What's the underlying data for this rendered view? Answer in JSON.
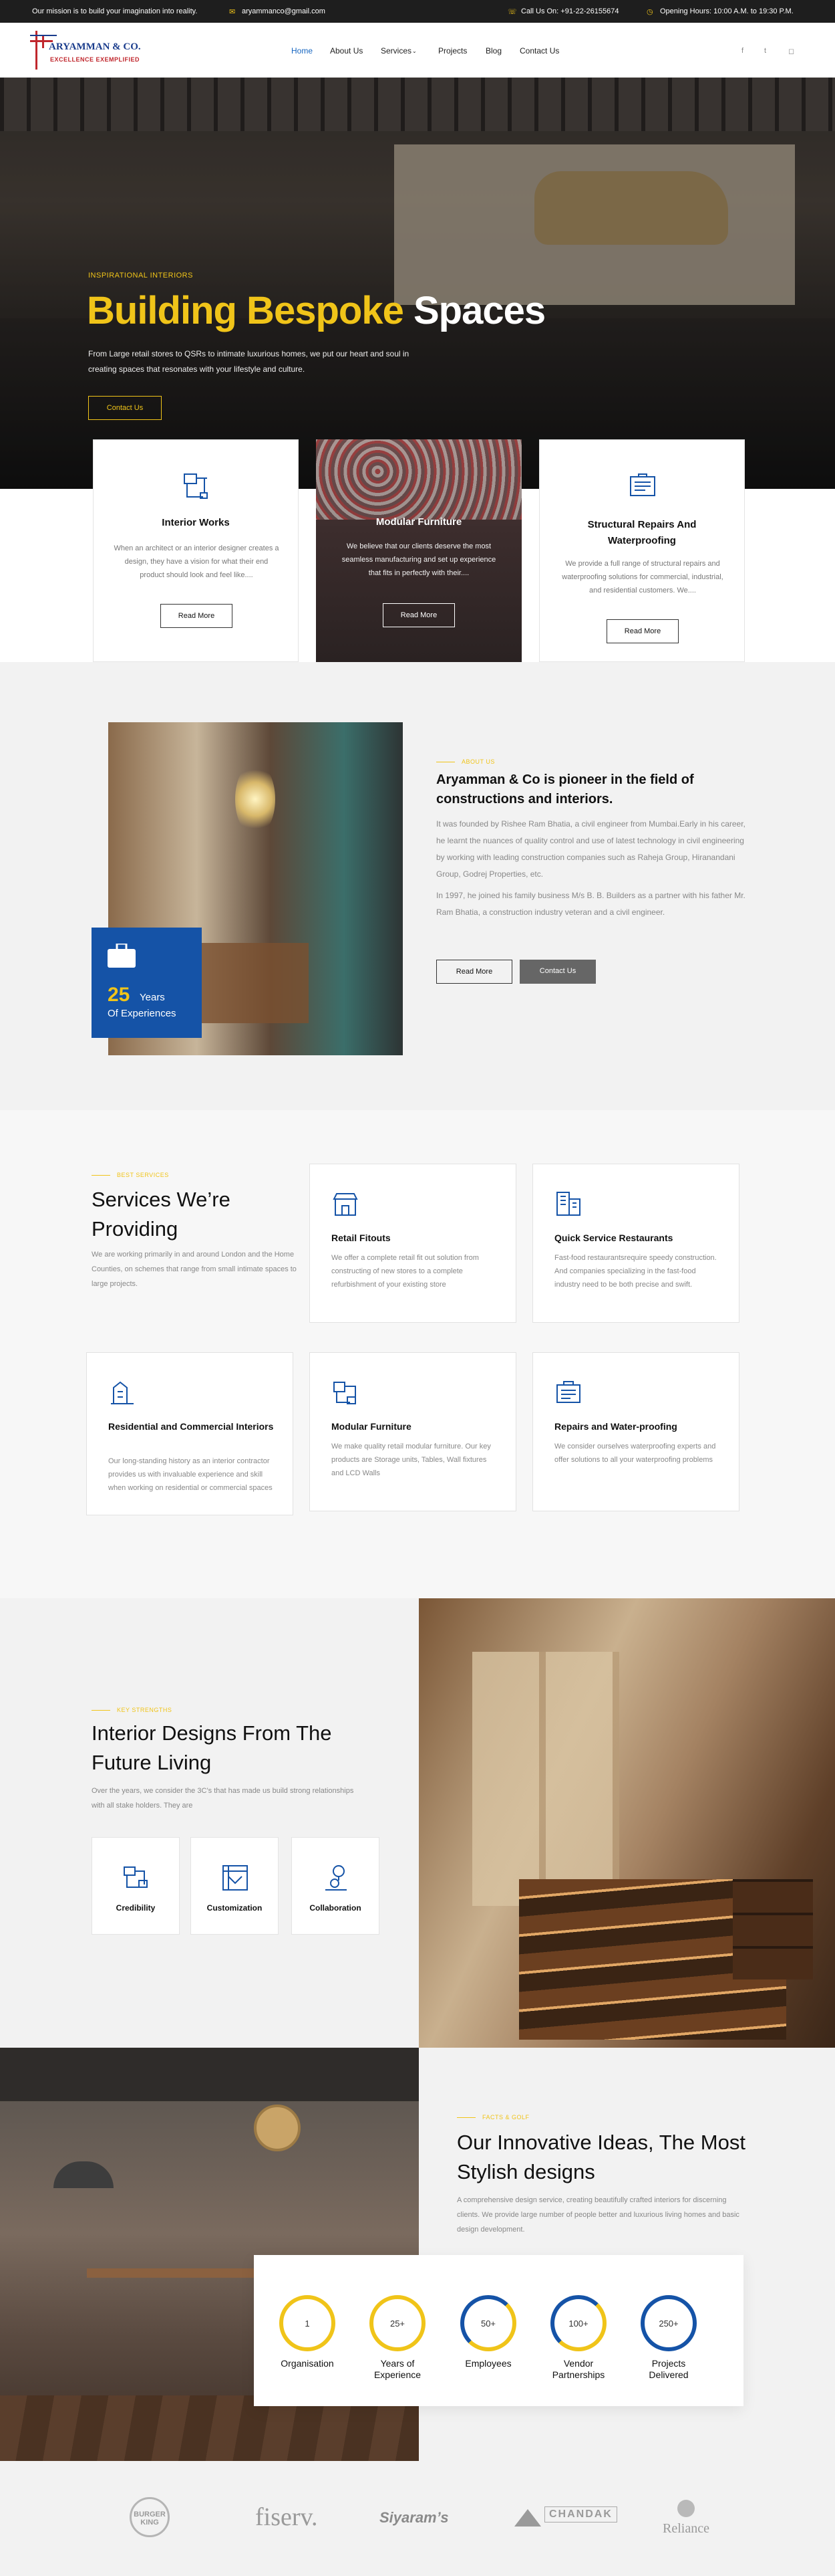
{
  "topbar": {
    "mission": "Our mission is to build your imagination into reality.",
    "email": "aryammanco@gmail.com",
    "phone": "Call Us On: +91-22-26155674",
    "hours": "Opening Hours: 10:00 A.M. to 19:30 P.M."
  },
  "logo": {
    "name": "ARYAMMAN & CO.",
    "tagline": "EXCELLENCE  EXEMPLIFIED"
  },
  "nav": {
    "items": [
      "Home",
      "About Us",
      "Services",
      "Projects",
      "Blog",
      "Contact Us"
    ],
    "active": "Home"
  },
  "social": {
    "icons": [
      "facebook-icon",
      "twitter-icon",
      "instagram-icon"
    ]
  },
  "hero": {
    "kicker": "INSPIRATIONAL INTERIORS",
    "title_highlight": "Building Bespoke",
    "title_rest": "Spaces",
    "text": "From Large retail stores to QSRs to intimate luxurious homes, we put our heart and soul in creating spaces that resonates with your lifestyle and culture.",
    "button": "Contact Us"
  },
  "feature_cards": [
    {
      "title": "Interior Works",
      "text": "When an architect or an interior designer creates a design, they have a vision for what their end product should look and feel like....",
      "button": "Read More",
      "icon": "crane-icon"
    },
    {
      "title": "Modular Furniture",
      "text": "We believe that our clients deserve the most seamless manufacturing and set up experience that fits in perfectly with their....",
      "button": "Read More",
      "icon": "furniture-icon"
    },
    {
      "title": "Structural Repairs And Waterproofing",
      "text": "We provide a full range of structural repairs and waterproofing solutions for commercial, industrial, and residential customers. We....",
      "button": "Read More",
      "icon": "repair-icon"
    }
  ],
  "about": {
    "kicker": "ABOUT US",
    "title": "Aryamman & Co is pioneer in the field of constructions and interiors.",
    "p1": "It was founded by Rishee Ram Bhatia, a civil engineer from Mumbai.Early in his career, he learnt the nuances of quality control and use of latest technology in civil engineering by working with leading construction companies such as Raheja Group, Hiranandani Group, Godrej Properties, etc.",
    "p2": "In 1997, he joined his family business M/s B. B. Builders as a partner with his father Mr. Ram Bhatia, a construction industry veteran and a civil engineer.",
    "read_more": "Read More",
    "contact": "Contact Us",
    "exp_number": "25",
    "exp_label1": "Years",
    "exp_label2": "Of Experiences"
  },
  "services": {
    "kicker": "BEST SERVICES",
    "title": "Services We’re Providing",
    "intro": "We are working primarily in and around London and the Home Counties, on schemes that range from small intimate spaces to large projects.",
    "items": [
      {
        "title": "Retail Fitouts",
        "text": "We offer a complete retail fit out solution from constructing of new stores to a complete refurbishment of your existing store",
        "icon": "storefront-icon"
      },
      {
        "title": "Quick Service Restaurants",
        "text": "Fast-food restaurantsrequire speedy construction. And companies specializing in the fast-food industry need to be both precise and swift.",
        "icon": "building-icon"
      },
      {
        "title": "Residential and Commercial Interiors",
        "text": "Our long-standing history as an interior contractor provides us with invaluable experience and skill when working on residential or commercial spaces",
        "icon": "construction-icon"
      },
      {
        "title": "Modular Furniture",
        "text": "We make quality retail modular furniture. Our key products are Storage units, Tables, Wall fixtures and LCD Walls",
        "icon": "furniture-icon"
      },
      {
        "title": "Repairs and Water-proofing",
        "text": "We consider ourselves waterproofing experts and offer solutions to all your waterproofing problems",
        "icon": "tools-icon"
      }
    ]
  },
  "strength": {
    "kicker": "KEY STRENGTHS",
    "title": "Interior Designs From The Future Living",
    "text": "Over the years, we consider the 3C’s that has made us build strong relationships with all stake holders. They are",
    "items": [
      {
        "label": "Credibility",
        "icon": "handshake-icon"
      },
      {
        "label": "Customization",
        "icon": "blueprint-icon"
      },
      {
        "label": "Collaboration",
        "icon": "team-icon"
      }
    ]
  },
  "innov": {
    "kicker": "FACTS & GOLF",
    "title": "Our Innovative Ideas, The Most Stylish designs",
    "text": "A comprehensive design service, creating beautifully crafted interiors for discerning clients. We provide large number of people better and luxurious living homes and basic design development."
  },
  "stats": [
    {
      "value": "1",
      "label1": "Organisation",
      "label2": ""
    },
    {
      "value": "25+",
      "label1": "Years of",
      "label2": "Experience"
    },
    {
      "value": "50+",
      "label1": "Employees",
      "label2": ""
    },
    {
      "value": "100+",
      "label1": "Vendor",
      "label2": "Partnerships"
    },
    {
      "value": "250+",
      "label1": "Projects",
      "label2": "Delivered"
    }
  ],
  "clients": [
    "BURGER KING",
    "fiserv.",
    "Siyaram’s",
    "CHANDAK",
    "Reliance"
  ],
  "colors": {
    "accent_yellow": "#f0c419",
    "brand_blue": "#1553a7",
    "dark": "#1e1e1e"
  }
}
